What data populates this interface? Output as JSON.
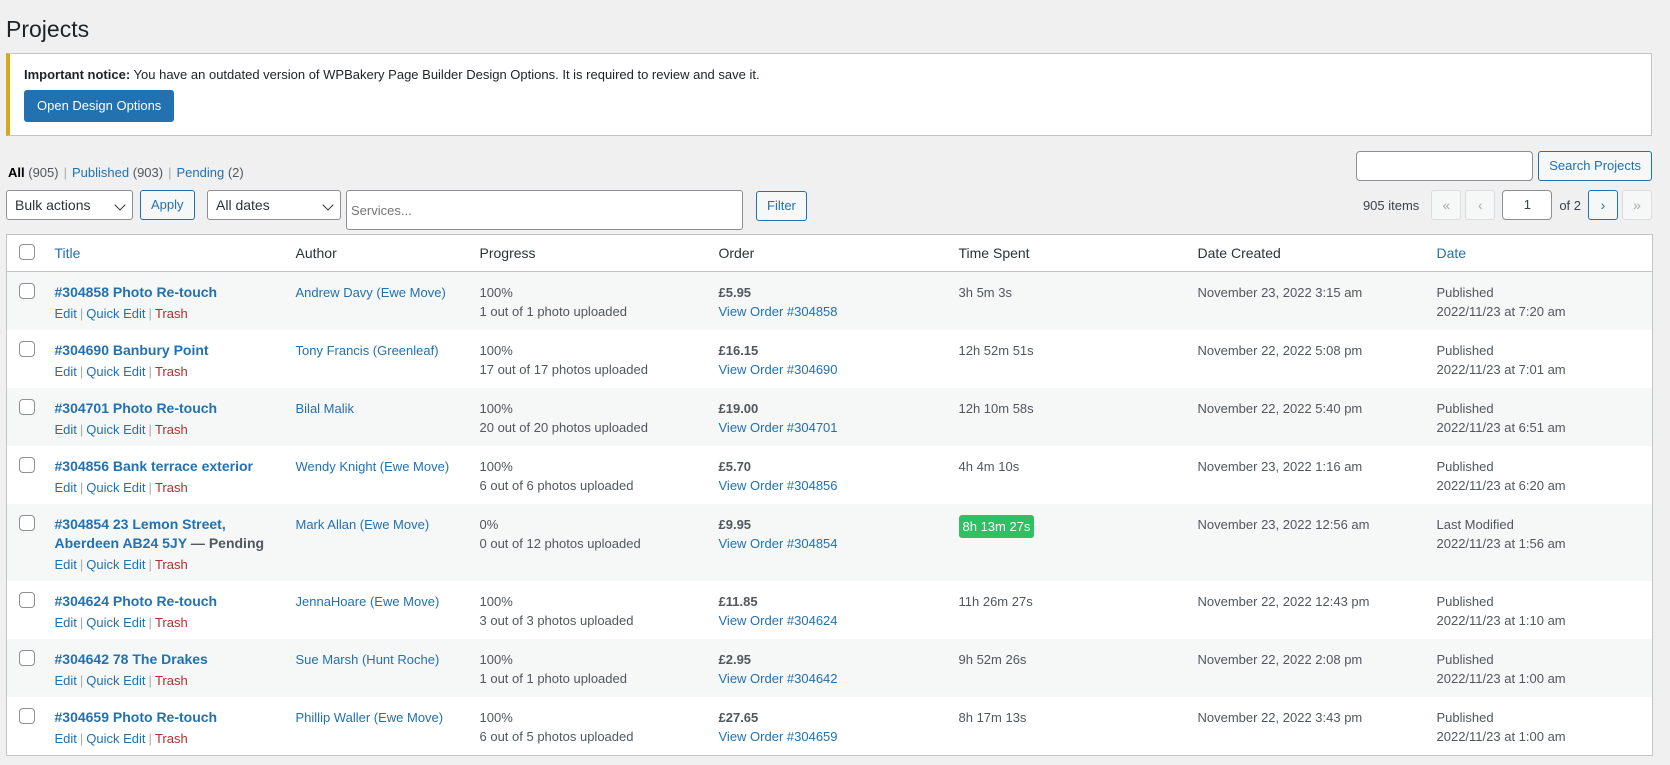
{
  "page": {
    "title": "Projects"
  },
  "notice": {
    "bold": "Important notice:",
    "text": " You have an outdated version of WPBakery Page Builder Design Options. It is required to review and save it.",
    "button": "Open Design Options"
  },
  "views": [
    {
      "label": "All",
      "count": "(905)"
    },
    {
      "label": "Published",
      "count": "(903)"
    },
    {
      "label": "Pending",
      "count": "(2)"
    }
  ],
  "search": {
    "value": "",
    "button": "Search Projects"
  },
  "filters": {
    "bulk_actions": "Bulk actions",
    "apply": "Apply",
    "dates": "All dates",
    "services_placeholder": "Services...",
    "filter": "Filter"
  },
  "pagination": {
    "count": "905 items",
    "first": "«",
    "prev": "‹",
    "current": "1",
    "of": "of 2",
    "next": "›",
    "last": "»"
  },
  "table": {
    "columns": [
      "Title",
      "Author",
      "Progress",
      "Order",
      "Time Spent",
      "Date Created",
      "Date"
    ],
    "actions": {
      "edit": "Edit",
      "quick_edit": "Quick Edit",
      "trash": "Trash"
    },
    "rows": [
      {
        "title": "#304858 Photo Re-touch",
        "state": "",
        "author": "Andrew Davy (Ewe Move)",
        "progress_pct": "100%",
        "progress_text": "1 out of 1 photo uploaded",
        "order_amount": "£5.95",
        "order_link": "View Order #304858",
        "time_spent": "3h 5m 3s",
        "highlight": false,
        "date_created": "November 23, 2022 3:15 am",
        "status": "Published",
        "date": "2022/11/23 at 7:20 am"
      },
      {
        "title": "#304690 Banbury Point",
        "state": "",
        "author": "Tony Francis (Greenleaf)",
        "progress_pct": "100%",
        "progress_text": "17 out of 17 photos uploaded",
        "order_amount": "£16.15",
        "order_link": "View Order #304690",
        "time_spent": "12h 52m 51s",
        "highlight": false,
        "date_created": "November 22, 2022 5:08 pm",
        "status": "Published",
        "date": "2022/11/23 at 7:01 am"
      },
      {
        "title": "#304701 Photo Re-touch",
        "state": "",
        "author": "Bilal Malik",
        "progress_pct": "100%",
        "progress_text": "20 out of 20 photos uploaded",
        "order_amount": "£19.00",
        "order_link": "View Order #304701",
        "time_spent": "12h 10m 58s",
        "highlight": false,
        "date_created": "November 22, 2022 5:40 pm",
        "status": "Published",
        "date": "2022/11/23 at 6:51 am"
      },
      {
        "title": "#304856 Bank terrace exterior",
        "state": "",
        "author": "Wendy Knight (Ewe Move)",
        "progress_pct": "100%",
        "progress_text": "6 out of 6 photos uploaded",
        "order_amount": "£5.70",
        "order_link": "View Order #304856",
        "time_spent": "4h 4m 10s",
        "highlight": false,
        "date_created": "November 23, 2022 1:16 am",
        "status": "Published",
        "date": "2022/11/23 at 6:20 am"
      },
      {
        "title": "#304854 23 Lemon Street, Aberdeen AB24 5JY",
        "state": " — Pending",
        "author": "Mark Allan (Ewe Move)",
        "progress_pct": "0%",
        "progress_text": "0 out of 12 photos uploaded",
        "order_amount": "£9.95",
        "order_link": "View Order #304854",
        "time_spent": "8h 13m 27s",
        "highlight": true,
        "date_created": "November 23, 2022 12:56 am",
        "status": "Last Modified",
        "date": "2022/11/23 at 1:56 am"
      },
      {
        "title": "#304624 Photo Re-touch",
        "state": "",
        "author": "JennaHoare (Ewe Move)",
        "progress_pct": "100%",
        "progress_text": "3 out of 3 photos uploaded",
        "order_amount": "£11.85",
        "order_link": "View Order #304624",
        "time_spent": "11h 26m 27s",
        "highlight": false,
        "date_created": "November 22, 2022 12:43 pm",
        "status": "Published",
        "date": "2022/11/23 at 1:10 am"
      },
      {
        "title": "#304642 78 The Drakes",
        "state": "",
        "author": "Sue Marsh (Hunt Roche)",
        "progress_pct": "100%",
        "progress_text": "1 out of 1 photo uploaded",
        "order_amount": "£2.95",
        "order_link": "View Order #304642",
        "time_spent": "9h 52m 26s",
        "highlight": false,
        "date_created": "November 22, 2022 2:08 pm",
        "status": "Published",
        "date": "2022/11/23 at 1:00 am"
      },
      {
        "title": "#304659 Photo Re-touch",
        "state": "",
        "author": "Phillip Waller (Ewe Move)",
        "progress_pct": "100%",
        "progress_text": "6 out of 5 photos uploaded",
        "order_amount": "£27.65",
        "order_link": "View Order #304659",
        "time_spent": "8h 17m 13s",
        "highlight": false,
        "date_created": "November 22, 2022 3:43 pm",
        "status": "Published",
        "date": "2022/11/23 at 1:00 am"
      }
    ]
  }
}
